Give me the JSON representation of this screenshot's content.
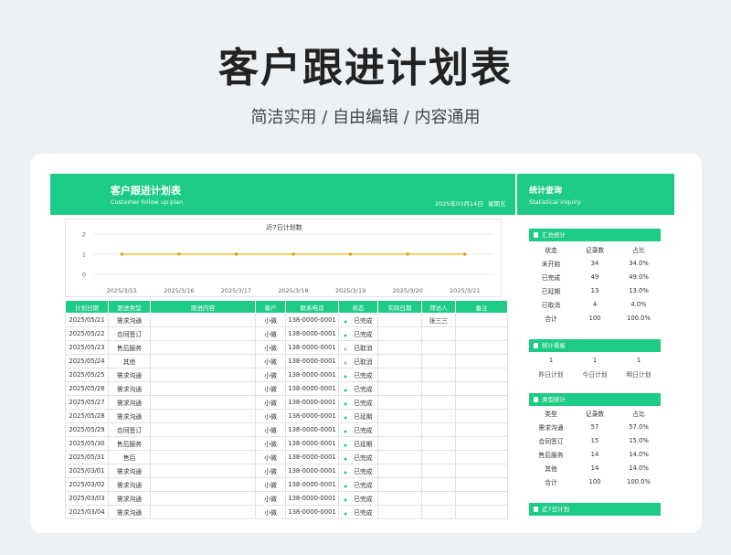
{
  "hero": {
    "title": "客户跟进计划表",
    "subtitle": "简洁实用 / 自由编辑 / 内容通用"
  },
  "sheet": {
    "title": "客户跟进计划表",
    "subtitle": "Customer follow up plan",
    "date": "2025年03月14日",
    "weekday": "星期五"
  },
  "stats_header": {
    "title": "统计查询",
    "subtitle": "Statistical inquiry"
  },
  "chart_data": {
    "type": "line",
    "title": "近7日计划数",
    "categories": [
      "2025/3/15",
      "2025/3/16",
      "2025/3/17",
      "2025/3/18",
      "2025/3/19",
      "2025/3/20",
      "2025/3/21"
    ],
    "series": [
      {
        "values": [
          1,
          1,
          1,
          1,
          1,
          1,
          1
        ]
      }
    ],
    "ylim": [
      0,
      2
    ],
    "yticks": [
      "0",
      "1",
      "2"
    ],
    "color": "#e8b900",
    "grid": true
  },
  "table": {
    "headers": [
      "计划日期",
      "跟进类型",
      "跟进内容",
      "客户",
      "联系电话",
      "状态",
      "实际日期",
      "拜访人",
      "备注"
    ],
    "rows": [
      [
        "2025/05/21",
        "需求沟通",
        "",
        "小微",
        "138-0000-0001",
        "已完成",
        "",
        "张三三",
        ""
      ],
      [
        "2025/05/22",
        "合同签订",
        "",
        "小微",
        "138-0000-0001",
        "已完成",
        "",
        "",
        ""
      ],
      [
        "2025/05/23",
        "售后服务",
        "",
        "小微",
        "138-0000-0001",
        "已取消",
        "",
        "",
        ""
      ],
      [
        "2025/05/24",
        "其他",
        "",
        "小微",
        "138-0000-0001",
        "已取消",
        "",
        "",
        ""
      ],
      [
        "2025/05/25",
        "需求沟通",
        "",
        "小微",
        "138-0000-0001",
        "已完成",
        "",
        "",
        ""
      ],
      [
        "2025/05/26",
        "需求沟通",
        "",
        "小微",
        "138-0000-0001",
        "已完成",
        "",
        "",
        ""
      ],
      [
        "2025/05/27",
        "需求沟通",
        "",
        "小微",
        "138-0000-0001",
        "已完成",
        "",
        "",
        ""
      ],
      [
        "2025/05/28",
        "需求沟通",
        "",
        "小微",
        "138-0000-0001",
        "已延期",
        "",
        "",
        ""
      ],
      [
        "2025/05/29",
        "合同签订",
        "",
        "小微",
        "138-0000-0001",
        "已完成",
        "",
        "",
        ""
      ],
      [
        "2025/05/30",
        "售后服务",
        "",
        "小微",
        "138-0000-0001",
        "已延期",
        "",
        "",
        ""
      ],
      [
        "2025/05/31",
        "售后",
        "",
        "小微",
        "138-0000-0001",
        "已完成",
        "",
        "",
        ""
      ],
      [
        "2025/03/01",
        "需求沟通",
        "",
        "小微",
        "138-0000-0001",
        "已完成",
        "",
        "",
        ""
      ],
      [
        "2025/03/02",
        "需求沟通",
        "",
        "小微",
        "138-0000-0001",
        "已完成",
        "",
        "",
        ""
      ],
      [
        "2025/03/03",
        "需求沟通",
        "",
        "小微",
        "138-0000-0001",
        "已完成",
        "",
        "",
        ""
      ],
      [
        "2025/03/04",
        "需求沟通",
        "",
        "小微",
        "138-0000-0001",
        "已完成",
        "",
        "",
        ""
      ]
    ]
  },
  "summary": {
    "title": "汇总统计",
    "headers": [
      "状态",
      "记录数",
      "占比"
    ],
    "rows": [
      [
        "未开始",
        "34",
        "34.0%"
      ],
      [
        "已完成",
        "49",
        "49.0%"
      ],
      [
        "已延期",
        "13",
        "13.0%"
      ],
      [
        "已取消",
        "4",
        "4.0%"
      ],
      [
        "合计",
        "100",
        "100.0%"
      ]
    ]
  },
  "board": {
    "title": "统计看板",
    "values": [
      "1",
      "1",
      "1"
    ],
    "labels": [
      "昨日计划",
      "今日计划",
      "明日计划"
    ]
  },
  "types": {
    "title": "类型统计",
    "headers": [
      "类型",
      "记录数",
      "占比"
    ],
    "rows": [
      [
        "需求沟通",
        "57",
        "57.0%"
      ],
      [
        "合同签订",
        "15",
        "15.0%"
      ],
      [
        "售后服务",
        "14",
        "14.0%"
      ],
      [
        "其他",
        "14",
        "14.0%"
      ],
      [
        "合计",
        "100",
        "100.0%"
      ]
    ]
  },
  "recent": {
    "title": "近7日计划"
  },
  "colors": {
    "accent": "#1dcb84",
    "line": "#e8b900",
    "cancelled_dot": "#b0b0b0"
  }
}
